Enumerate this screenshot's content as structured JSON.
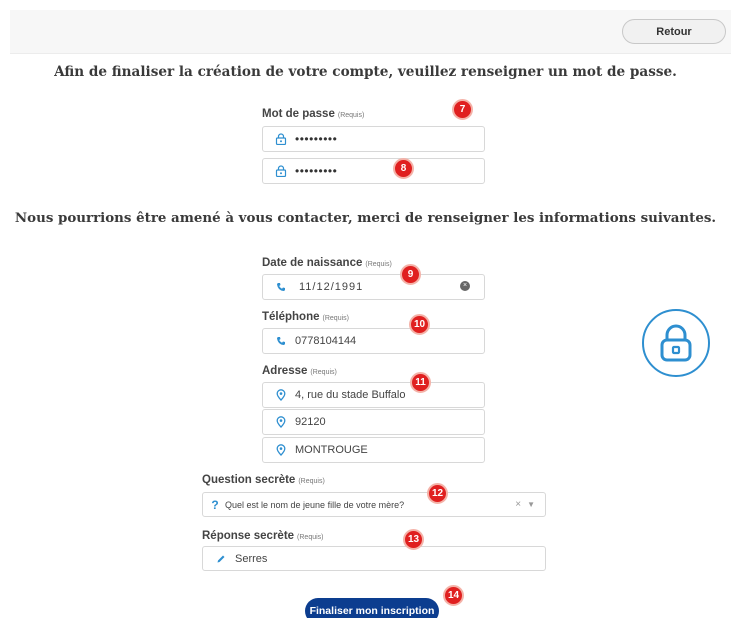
{
  "header": {
    "back_label": "Retour"
  },
  "intro": {
    "password_heading": "Afin de finaliser la création de votre compte, veuillez renseigner un mot de passe.",
    "contact_heading": "Nous pourrions être amené à vous contacter, merci de renseigner les informations suivantes."
  },
  "required_tag": "(Requis)",
  "password": {
    "label": "Mot de passe",
    "value_masked": "•••••••••",
    "confirm_masked": "•••••••••"
  },
  "birthdate": {
    "label": "Date de naissance",
    "value": "11/12/1991"
  },
  "phone": {
    "label": "Téléphone",
    "value": "0778104144"
  },
  "address": {
    "label": "Adresse",
    "street": "4, rue du stade Buffalo",
    "postal_code": "92120",
    "city": "MONTROUGE"
  },
  "secret_question": {
    "label": "Question secrète",
    "value": "Quel est le nom de jeune fille de votre mère?"
  },
  "secret_answer": {
    "label": "Réponse secrète",
    "value": "Serres"
  },
  "submit_label": "Finaliser mon inscription",
  "badges": [
    "7",
    "8",
    "9",
    "10",
    "11",
    "12",
    "13",
    "14"
  ],
  "colors": {
    "accent": "#2e8fd0",
    "primary_button": "#0c3d8f",
    "badge": "#e02020"
  },
  "icons": {
    "lock": "lock-icon",
    "phone": "phone-icon",
    "location": "location-pin-icon",
    "question": "question-icon",
    "pencil": "pencil-icon",
    "clear": "clear-icon",
    "chevron": "chevron-down-icon"
  }
}
